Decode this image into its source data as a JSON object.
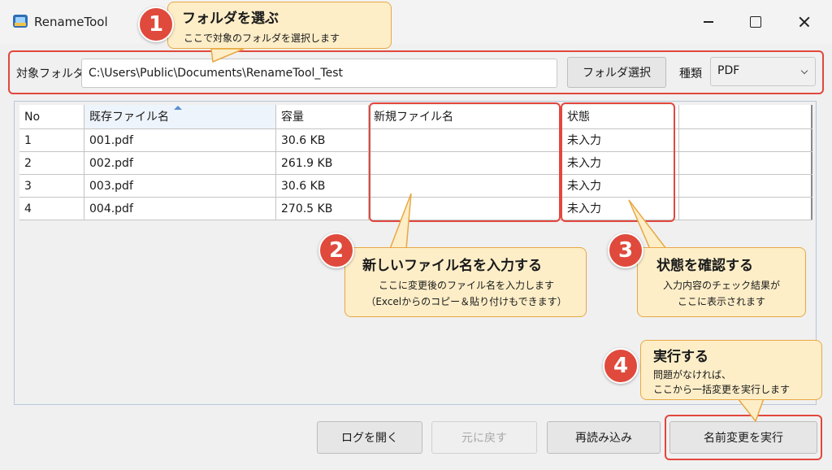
{
  "window": {
    "title": "RenameTool"
  },
  "folder_row": {
    "label": "対象フォルダ",
    "path": "C:\\Users\\Public\\Documents\\RenameTool_Test",
    "browse_button": "フォルダ選択",
    "type_label": "種類",
    "type_value": "PDF"
  },
  "table": {
    "headers": [
      "No",
      "既存ファイル名",
      "容量",
      "新規ファイル名",
      "状態"
    ],
    "rows": [
      {
        "no": "1",
        "name": "001.pdf",
        "size": "30.6 KB",
        "new_name": "",
        "status": "未入力"
      },
      {
        "no": "2",
        "name": "002.pdf",
        "size": "261.9 KB",
        "new_name": "",
        "status": "未入力"
      },
      {
        "no": "3",
        "name": "003.pdf",
        "size": "30.6 KB",
        "new_name": "",
        "status": "未入力"
      },
      {
        "no": "4",
        "name": "004.pdf",
        "size": "270.5 KB",
        "new_name": "",
        "status": "未入力"
      }
    ]
  },
  "buttons": {
    "open_log": "ログを開く",
    "undo": "元に戻す",
    "reload": "再読み込み",
    "execute": "名前変更を実行"
  },
  "callouts": {
    "c1": {
      "number": "1",
      "title": "フォルダを選ぶ",
      "text": "ここで対象のフォルダを選択します"
    },
    "c2": {
      "number": "2",
      "title": "新しいファイル名を入力する",
      "line1": "ここに変更後のファイル名を入力します",
      "line2": "（Excelからのコピー＆貼り付けもできます）"
    },
    "c3": {
      "number": "3",
      "title": "状態を確認する",
      "line1": "入力内容のチェック結果が",
      "line2": "ここに表示されます"
    },
    "c4": {
      "number": "4",
      "title": "実行する",
      "line1": "問題がなければ、",
      "line2": "ここから一括変更を実行します"
    }
  },
  "colors": {
    "highlight": "#e2473d",
    "badge": "#df4a3c",
    "bubble_fill": "#fdeec8",
    "bubble_border": "#e8a844"
  }
}
